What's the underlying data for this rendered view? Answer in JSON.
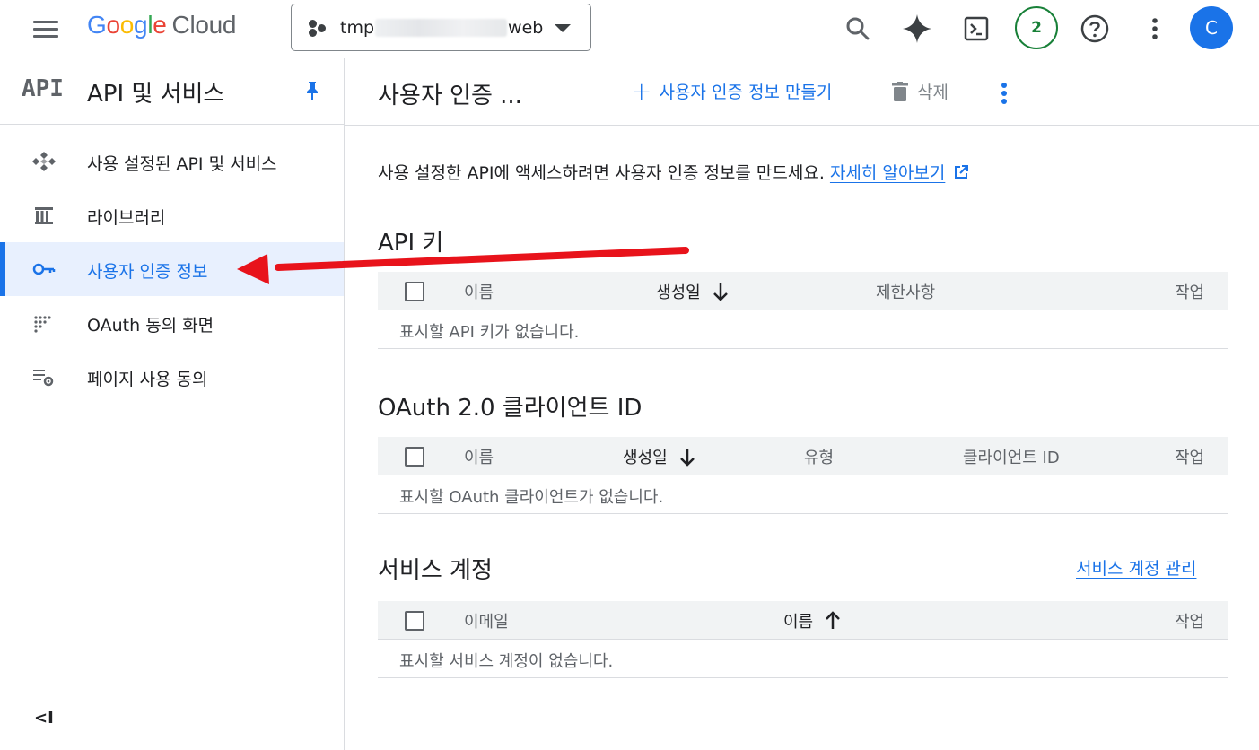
{
  "topbar": {
    "logo_letters": [
      "G",
      "o",
      "o",
      "g",
      "l",
      "e"
    ],
    "logo_cloud": "Cloud",
    "project_prefix": "tmp",
    "project_suffix": "web",
    "notifications_count": "2",
    "avatar_initial": "C",
    "icons": [
      "menu-icon",
      "search-icon",
      "gemini-icon",
      "cloud-shell-icon",
      "help-icon",
      "more-vert-icon"
    ]
  },
  "sidebar": {
    "logo": "API",
    "title": "API 및 서비스",
    "items": [
      {
        "label": "사용 설정된 API 및 서비스",
        "icon": "api-diamond-icon"
      },
      {
        "label": "라이브러리",
        "icon": "library-icon"
      },
      {
        "label": "사용자 인증 정보",
        "icon": "key-icon",
        "active": true
      },
      {
        "label": "OAuth 동의 화면",
        "icon": "oauth-dots-icon"
      },
      {
        "label": "페이지 사용 동의",
        "icon": "settings-list-icon"
      }
    ],
    "collapse_label": "<I"
  },
  "main": {
    "title": "사용자 인증 ...",
    "create_label": "사용자 인증 정보 만들기",
    "delete_label": "삭제",
    "intro_text": "사용 설정한 API에 액세스하려면 사용자 인증 정보를 만드세요. ",
    "learn_more": "자세히 알아보기",
    "api_keys": {
      "title": "API 키",
      "columns": [
        "이름",
        "생성일",
        "제한사항",
        "작업"
      ],
      "empty": "표시할 API 키가 없습니다."
    },
    "oauth": {
      "title": "OAuth 2.0 클라이언트 ID",
      "columns": [
        "이름",
        "생성일",
        "유형",
        "클라이언트 ID",
        "작업"
      ],
      "empty": "표시할 OAuth 클라이언트가 없습니다."
    },
    "service_accounts": {
      "title": "서비스 계정",
      "manage_link": "서비스 계정 관리",
      "columns": [
        "이메일",
        "이름",
        "작업"
      ],
      "empty": "표시할 서비스 계정이 없습니다."
    }
  },
  "colors": {
    "accent": "#1a73e8",
    "annotation_arrow": "#e8131b",
    "badge_green": "#188038"
  }
}
